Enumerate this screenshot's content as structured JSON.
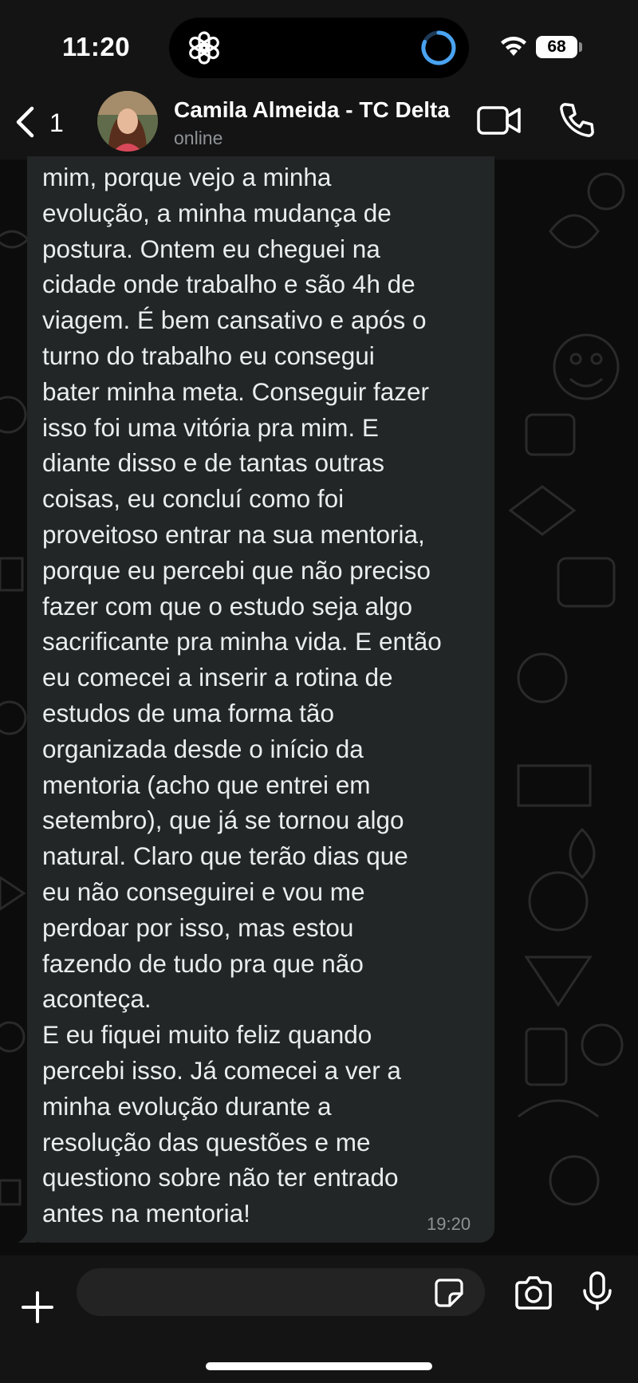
{
  "status_bar": {
    "time": "11:20",
    "battery": "68",
    "icons": [
      "chatgpt-icon",
      "loading-ring-icon",
      "wifi-icon",
      "battery-icon"
    ]
  },
  "header": {
    "back_count": "1",
    "contact_name": "Camila Almeida - TC Delta",
    "contact_status": "online",
    "icons": [
      "chevron-left-icon",
      "video-call-icon",
      "voice-call-icon"
    ]
  },
  "message": {
    "text": "mim, porque vejo a minha\nevolução, a minha mudança de\npostura. Ontem eu cheguei na\ncidade onde trabalho e são 4h de\nviagem. É bem cansativo e após o\nturno do trabalho eu consegui\nbater minha meta. Conseguir fazer\nisso foi uma vitória pra mim. E\ndiante disso e de tantas outras\ncoisas, eu concluí como foi\nproveitoso entrar na sua mentoria,\nporque eu percebi que não preciso\nfazer com que o estudo seja algo\nsacrificante pra minha vida. E então\neu comecei a inserir a rotina de\nestudos de uma forma tão\norganizada desde o início da\nmentoria (acho que entrei em\nsetembro), que já se tornou algo\nnatural. Claro que terão dias que\neu não conseguirei e vou me\nperdoar por isso, mas estou\nfazendo de tudo pra que não\naconteça.\nE eu fiquei muito feliz quando\npercebi isso. Já comecei a ver a\nminha evolução durante a\nresolução das questões e me\nquestiono sobre não ter entrado\nantes na mentoria!",
    "time": "19:20"
  },
  "composer": {
    "icons": [
      "plus-icon",
      "sticker-icon",
      "camera-icon",
      "microphone-icon"
    ]
  },
  "colors": {
    "background": "#0c0c0c",
    "bar": "#141414",
    "bubble": "#232626",
    "text": "#e9edef",
    "muted": "#8e9296",
    "accent_blue": "#4aa3f0"
  }
}
